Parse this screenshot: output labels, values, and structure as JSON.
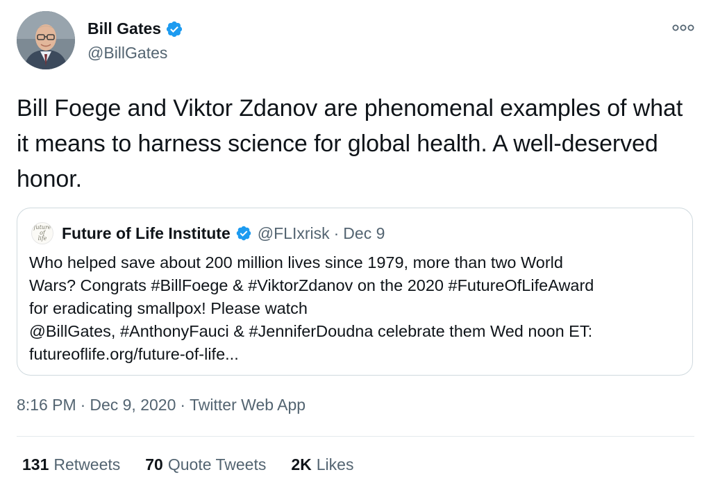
{
  "tweet": {
    "author": {
      "name": "Bill Gates",
      "handle": "@BillGates",
      "verified": true,
      "avatar_icon": "profile-photo"
    },
    "more_icon": "more-options-icon",
    "text": "Bill Foege and Viktor Zdanov are phenomenal examples of what it means to harness science for global health. A well-deserved honor.",
    "quoted": {
      "avatar_text_line1": "future",
      "avatar_text_line2": "of",
      "avatar_text_line3": "life",
      "name": "Future of Life Institute",
      "verified": true,
      "handle": "@FLIxrisk",
      "separator": "·",
      "date": "Dec 9",
      "lines": [
        "Who helped save about 200 million lives since 1979, more than two World",
        "Wars? Congrats #BillFoege & #ViktorZdanov on the 2020 #FutureOfLifeAward",
        "for eradicating smallpox! Please watch",
        "@BillGates, #AnthonyFauci & #JenniferDoudna celebrate them Wed noon ET:",
        "futureoflife.org/future-of-life..."
      ]
    },
    "meta": {
      "time": "8:16 PM",
      "separator": "·",
      "date": "Dec 9, 2020",
      "source": "Twitter Web App"
    },
    "stats": {
      "retweets_count": "131",
      "retweets_label": "Retweets",
      "quotes_count": "70",
      "quotes_label": "Quote Tweets",
      "likes_count": "2K",
      "likes_label": "Likes"
    }
  },
  "colors": {
    "primary_text": "#0f1419",
    "secondary_text": "#536471",
    "verified_blue": "#1d9bf0",
    "border": "#cfd9de"
  }
}
